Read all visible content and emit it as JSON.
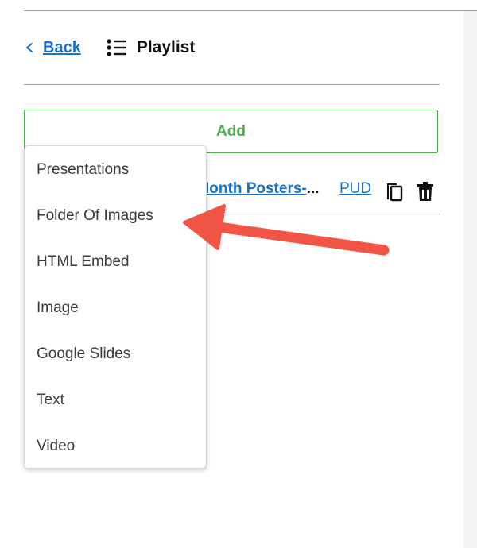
{
  "header": {
    "back_label": "Back",
    "title": "Playlist"
  },
  "add_button": {
    "label": "Add"
  },
  "playlist_item": {
    "name": "Ionth Posters-",
    "ellipsis": "...",
    "tag": "PUD"
  },
  "add_menu": {
    "items": [
      {
        "label": "Presentations"
      },
      {
        "label": "Folder Of Images"
      },
      {
        "label": "HTML Embed"
      },
      {
        "label": "Image"
      },
      {
        "label": "Google Slides"
      },
      {
        "label": "Text"
      },
      {
        "label": "Video"
      }
    ]
  },
  "colors": {
    "link": "#1a73c8",
    "add_green": "#4caf50",
    "annotation_arrow": "#f05545"
  },
  "icons": {
    "back": "chevron-left-icon",
    "playlist": "list-icon",
    "copy": "copy-icon",
    "delete": "trash-icon",
    "annotation": "red-arrow-annotation"
  }
}
